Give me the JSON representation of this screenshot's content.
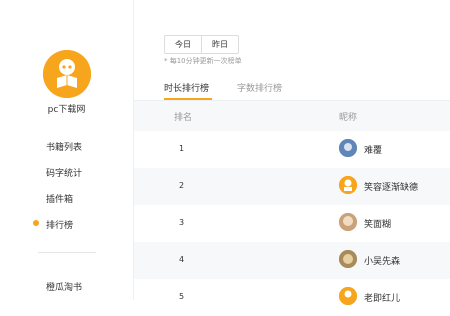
{
  "sidebar": {
    "username": "pc下载网",
    "menu": [
      "书籍列表",
      "码字统计",
      "插件箱",
      "排行榜"
    ],
    "active_index": 3,
    "extra_item": "橙瓜淘书"
  },
  "filters": {
    "today": "今日",
    "yesterday": "昨日"
  },
  "hint": "* 每10分钟更新一次榜单",
  "tabs": [
    "时长排行榜",
    "字数排行榜"
  ],
  "table": {
    "headers": {
      "rank": "排名",
      "name": "昵称"
    },
    "rows": [
      {
        "rank": "1",
        "name": "难覆"
      },
      {
        "rank": "2",
        "name": "笑容逐渐缺德"
      },
      {
        "rank": "3",
        "name": "笑面糊"
      },
      {
        "rank": "4",
        "name": "小吴先森"
      },
      {
        "rank": "5",
        "name": "老即红儿"
      }
    ]
  },
  "colors": {
    "accent": "#f7a51c"
  }
}
